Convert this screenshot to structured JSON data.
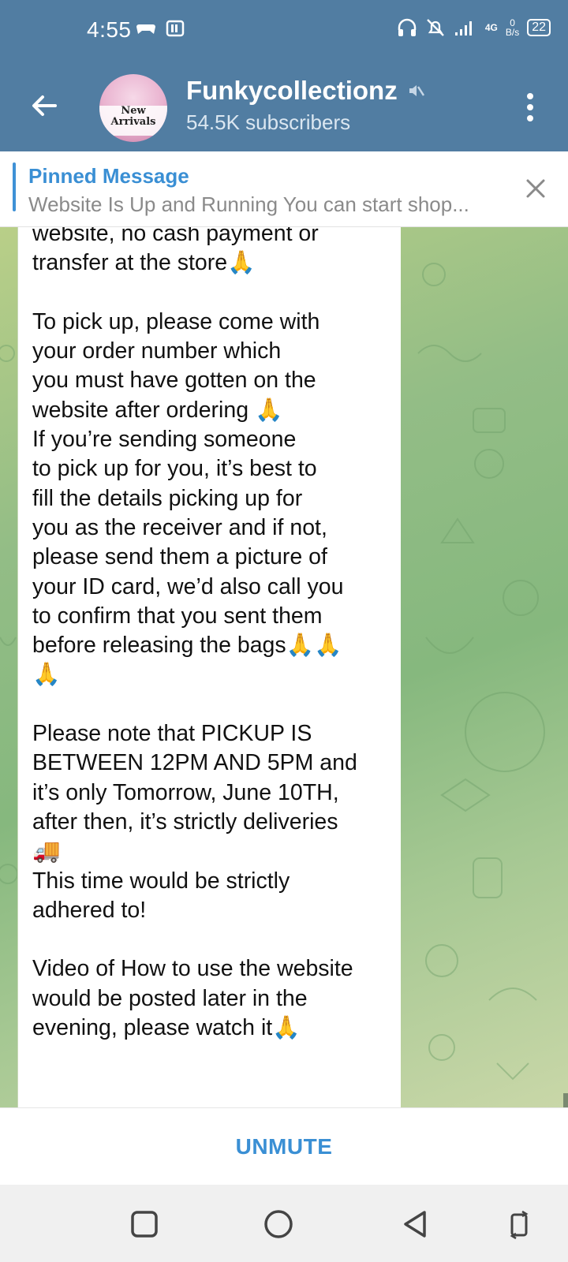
{
  "status_bar": {
    "time": "4:55",
    "network": "4G",
    "speed_value": "0",
    "speed_unit": "B/s",
    "battery": "22"
  },
  "header": {
    "title": "Funkycollectionz",
    "subscribers": "54.5K subscribers",
    "avatar_text": "New Arrivals",
    "colors": {
      "bar": "#517da2",
      "accent": "#3a8fd4"
    }
  },
  "pinned": {
    "title": "Pinned Message",
    "text": "Website Is Up and Running  You can start shop..."
  },
  "message": {
    "text": "website, no cash payment or\ntransfer at the store🙏\n\nTo pick up, please come with\nyour order number which\nyou must have gotten on the\nwebsite after ordering 🙏\nIf you’re sending someone\nto pick up for you, it’s best to\nfill the details picking up for\nyou as the receiver and if not,\nplease send them a picture of\nyour ID card, we’d also call you\nto confirm that you sent them\nbefore releasing the bags🙏🙏\n🙏\n\nPlease note that PICKUP IS\nBETWEEN 12PM AND 5PM and\nit’s only Tomorrow, June 10TH,\nafter then, it’s strictly deliveries\n🚚\nThis time would be strictly\nadhered to!\n\nVideo of How to use the website\nwould be posted later in the\nevening, please watch it🙏"
  },
  "bottom": {
    "unmute_label": "UNMUTE"
  },
  "nav": {
    "icons": [
      "recents-square-icon",
      "home-circle-icon",
      "back-triangle-icon",
      "rotate-icon"
    ]
  }
}
